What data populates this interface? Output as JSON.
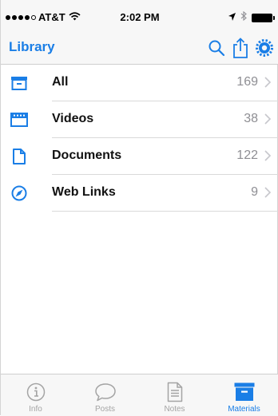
{
  "colors": {
    "accent": "#1a7ee6",
    "inactive": "#a4a4a4",
    "count": "#8e8e93"
  },
  "status_bar": {
    "carrier": "AT&T",
    "time": "2:02 PM"
  },
  "nav": {
    "title": "Library",
    "actions": [
      {
        "name": "search",
        "icon": "search-icon"
      },
      {
        "name": "share",
        "icon": "share-icon"
      },
      {
        "name": "settings",
        "icon": "gear-icon"
      }
    ]
  },
  "list": {
    "items": [
      {
        "label": "All",
        "count": "169",
        "icon": "box-icon"
      },
      {
        "label": "Videos",
        "count": "38",
        "icon": "film-icon"
      },
      {
        "label": "Documents",
        "count": "122",
        "icon": "document-icon"
      },
      {
        "label": "Web Links",
        "count": "9",
        "icon": "compass-icon"
      }
    ]
  },
  "tabbar": {
    "tabs": [
      {
        "label": "Info",
        "icon": "info-icon",
        "active": false
      },
      {
        "label": "Posts",
        "icon": "speech-bubble-icon",
        "active": false
      },
      {
        "label": "Notes",
        "icon": "notes-icon",
        "active": false
      },
      {
        "label": "Materials",
        "icon": "box-icon",
        "active": true
      }
    ]
  }
}
